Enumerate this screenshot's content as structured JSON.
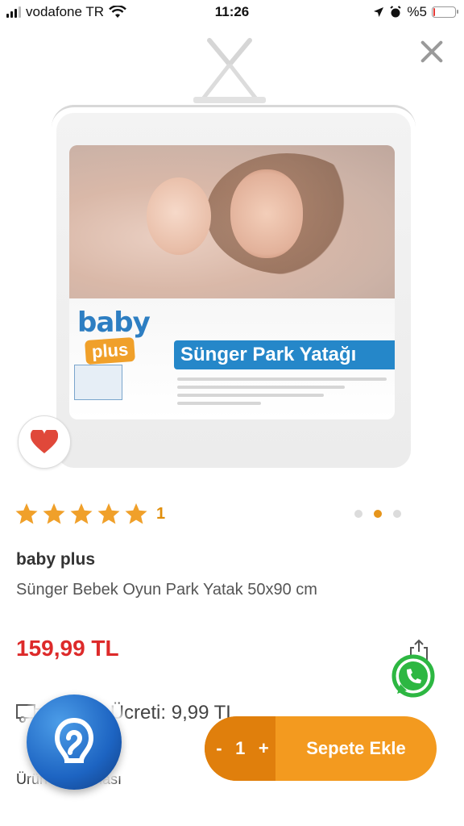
{
  "status_bar": {
    "carrier": "vodafone TR",
    "time": "11:26",
    "battery": "%5",
    "battery_level": 0.05
  },
  "product": {
    "rating_count": "1",
    "rating_stars": 5,
    "brand": "baby plus",
    "title": "Sünger Bebek Oyun Park Yatak 50x90 cm",
    "price": "159,99 TL",
    "shipping": "Kargo Ücreti: 9,99 TL",
    "description_link": "Ürün Açıklaması",
    "image_count": 3,
    "image_index": 2
  },
  "packaging": {
    "brand_top": "baby",
    "brand_bottom": "plus",
    "banner": "Sünger Park Yatağı"
  },
  "cart": {
    "minus": "-",
    "quantity": "1",
    "plus": "+",
    "add_label": "Sepete Ekle"
  },
  "colors": {
    "accent": "#f39a1f",
    "price": "#dd2a2a",
    "star": "#f0a02a"
  }
}
